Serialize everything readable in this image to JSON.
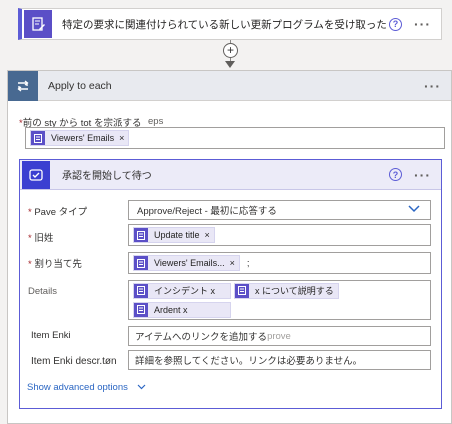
{
  "trigger": {
    "title": "特定の要求に関連付けられている新しい更新プログラムを受け取ったとき",
    "help": "?",
    "more": "···",
    "icon": "document-edit-icon"
  },
  "connector": {
    "plus": "+"
  },
  "apply_each": {
    "title": "Apply to each",
    "more": "···",
    "icon": "loop-icon",
    "field_label": "前の sty から tot を宗派する",
    "hint": "eps",
    "token": "Viewers' Emails"
  },
  "approval": {
    "title": "承認を開始して待つ",
    "help": "?",
    "more": "···",
    "icon": "approval-icon",
    "fields": {
      "type_label": "Pave タイプ",
      "type_value": "Approve/Reject - 最初に応答する",
      "title_label": "旧姓",
      "title_token": "Update title",
      "assign_label": "割り当て先",
      "assign_token": "Viewers' Emails...",
      "assign_suffix": ";",
      "details_label": "Details",
      "details_token1": "インシデント x",
      "details_text": "x について説明する",
      "details_token2": "Ardent x",
      "link_label": "Item Enki",
      "link_value": "アイテムへのリンクを追加する",
      "link_placeholder": "prove",
      "desc_label": "Item Enki descr.tøn",
      "desc_value": "詳細を参照してください。リンクは必要ありません。"
    },
    "advanced": "Show advanced options"
  },
  "colors": {
    "accent": "#5c5cd6",
    "link": "#2b66c3",
    "required": "#a4262c"
  }
}
